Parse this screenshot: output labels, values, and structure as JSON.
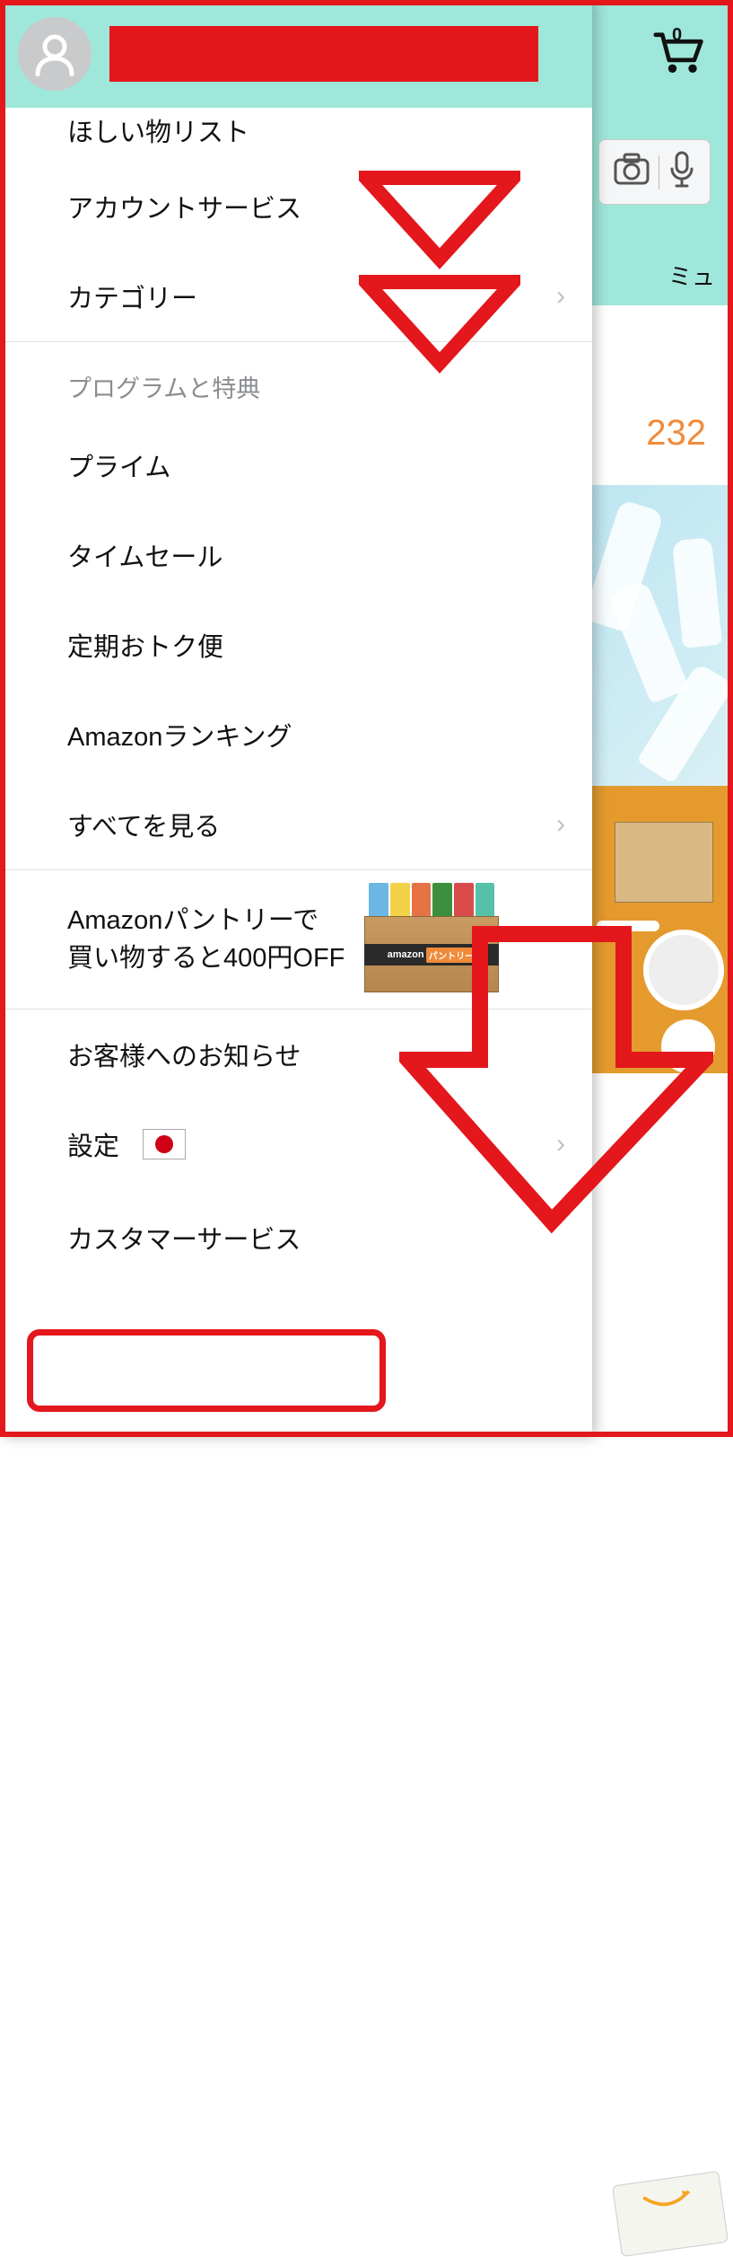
{
  "header": {
    "cart_count": "0"
  },
  "background": {
    "nav_fragment": "ミュ",
    "counter": "232",
    "pantry_brand1": "amazon",
    "pantry_brand2": "パントリー"
  },
  "drawer": {
    "section1": [
      {
        "label": "ほしい物リスト",
        "chevron": false
      },
      {
        "label": "アカウントサービス",
        "chevron": false
      },
      {
        "label": "カテゴリー",
        "chevron": true
      }
    ],
    "section2_title": "プログラムと特典",
    "section2": [
      {
        "label": "プライム",
        "chevron": false
      },
      {
        "label": "タイムセール",
        "chevron": false
      },
      {
        "label": "定期おトク便",
        "chevron": false
      },
      {
        "label": "Amazonランキング",
        "chevron": false
      },
      {
        "label": "すべてを見る",
        "chevron": true
      }
    ],
    "promo": {
      "line1": "Amazonパントリーで",
      "line2": "買い物すると400円OFF"
    },
    "section3": [
      {
        "label": "お客様へのお知らせ",
        "chevron": false,
        "flag": false
      },
      {
        "label": "設定",
        "chevron": true,
        "flag": true
      },
      {
        "label": "カスタマーサービス",
        "chevron": false,
        "flag": false
      }
    ]
  },
  "annotations": {
    "highlight_target": "カスタマーサービス"
  }
}
